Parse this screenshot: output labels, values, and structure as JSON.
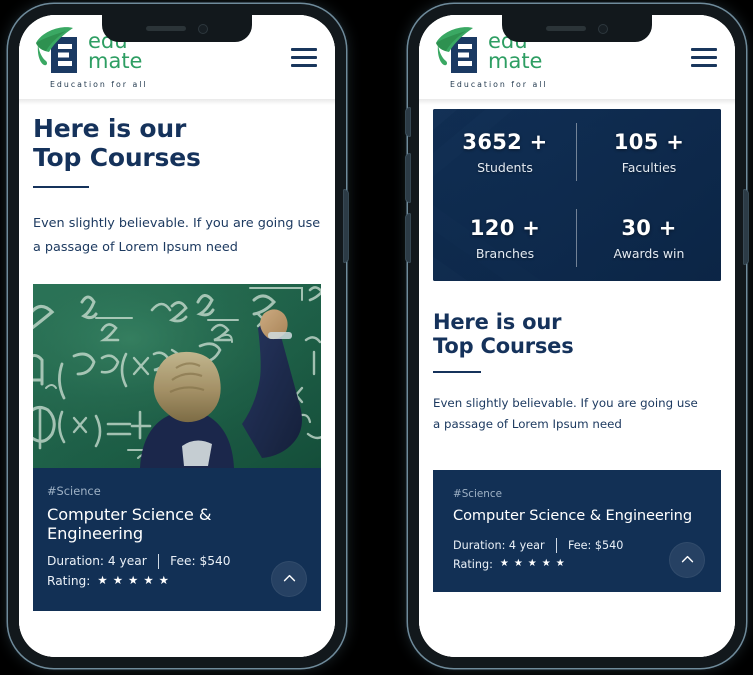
{
  "brand": {
    "name_line1": "edu",
    "name_line2": "mate",
    "tagline": "Education for all",
    "green": "#2e9e63",
    "navy": "#15325b",
    "cap_icon": "graduation-cap-icon",
    "menu_icon": "hamburger-menu-icon"
  },
  "phones": {
    "left": {
      "label": "Phone mockup — courses view"
    },
    "right": {
      "label": "Phone mockup — stats and courses view"
    }
  },
  "stats": {
    "items": [
      {
        "value": "3652 +",
        "label": "Students"
      },
      {
        "value": "105 +",
        "label": "Faculties"
      },
      {
        "value": "120 +",
        "label": "Branches"
      },
      {
        "value": "30 +",
        "label": "Awards win"
      }
    ]
  },
  "section": {
    "title_line1": "Here is our",
    "title_line2": "Top Courses",
    "description": "Even slightly believable. If you are going use a passage of Lorem Ipsum need"
  },
  "course": {
    "tag": "#Science",
    "name": "Computer Science & Engineering",
    "duration": "Duration: 4 year",
    "fee": "Fee: $540",
    "rating_label": "Rating:",
    "rating_stars": 5,
    "star_glyph": "★",
    "image_alt": "chalkboard-physics-equations-photo",
    "card_bg": "#123055"
  },
  "scroll_top": {
    "icon": "chevron-up-icon",
    "label": "Scroll to top"
  }
}
